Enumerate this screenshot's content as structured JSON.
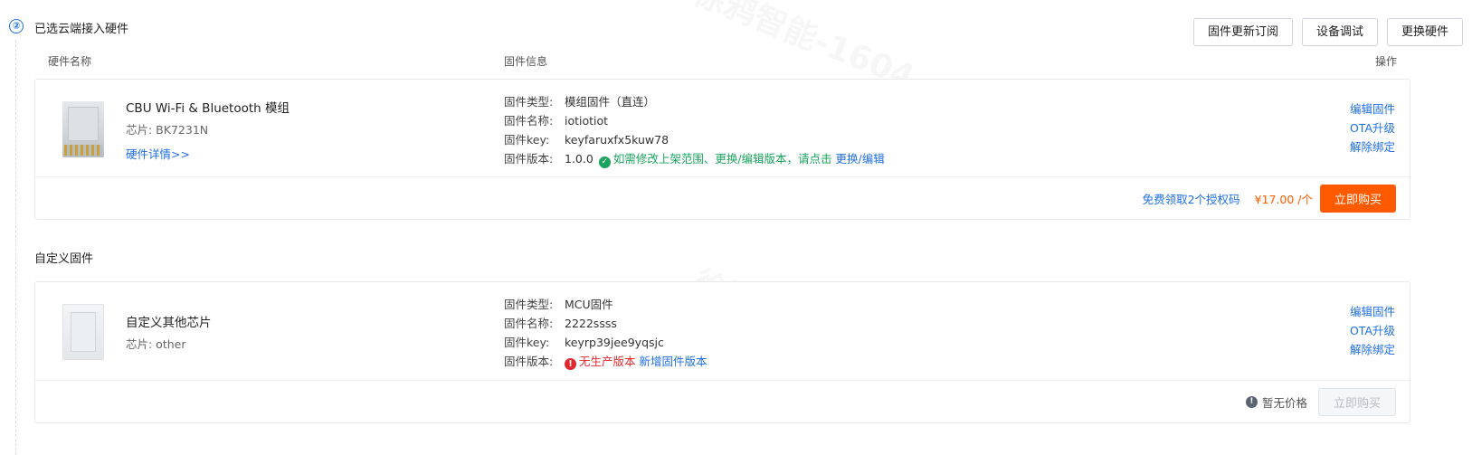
{
  "step": {
    "number": "②",
    "title": "已选云端接入硬件"
  },
  "top_actions": {
    "firmware_subscribe": "固件更新订阅",
    "device_debug": "设备调试",
    "replace_hardware": "更换硬件"
  },
  "columns": {
    "hardware_name": "硬件名称",
    "firmware_info": "固件信息",
    "operations": "操作"
  },
  "cloud_hardware": {
    "name": "CBU Wi-Fi & Bluetooth 模组",
    "chip": "芯片: BK7231N",
    "details_link": "硬件详情>>",
    "firmware": {
      "type_label": "固件类型:",
      "type_value": "模组固件（直连）",
      "name_label": "固件名称:",
      "name_value": "iotiotiot",
      "key_label": "固件key:",
      "key_value": "keyfaruxfx5kuw78",
      "version_label": "固件版本:",
      "version_value": "1.0.0",
      "version_note": "如需修改上架范围、更换/编辑版本，请点击",
      "version_link": "更换/编辑"
    },
    "ops": {
      "edit": "编辑固件",
      "ota": "OTA升级",
      "unbind": "解除绑定"
    },
    "free_license": "免费领取2个授权码",
    "price": "¥17.00 /个",
    "buy": "立即购买"
  },
  "custom_section_title": "自定义固件",
  "custom_hardware": {
    "name": "自定义其他芯片",
    "chip": "芯片: other",
    "firmware": {
      "type_label": "固件类型:",
      "type_value": "MCU固件",
      "name_label": "固件名称:",
      "name_value": "2222ssss",
      "key_label": "固件key:",
      "key_value": "keyrp39jee9yqsjc",
      "version_label": "固件版本:",
      "version_error": "无生产版本",
      "version_link": "新增固件版本"
    },
    "ops": {
      "edit": "编辑固件",
      "ota": "OTA升级",
      "unbind": "解除绑定"
    },
    "no_price": "暂无价格",
    "buy": "立即购买"
  },
  "watermark_text": "徐鸦智能-1604",
  "colors": {
    "primary": "#1f6fe5",
    "orange": "#ff5a00",
    "success": "#1aa35c",
    "error": "#e0282e"
  }
}
